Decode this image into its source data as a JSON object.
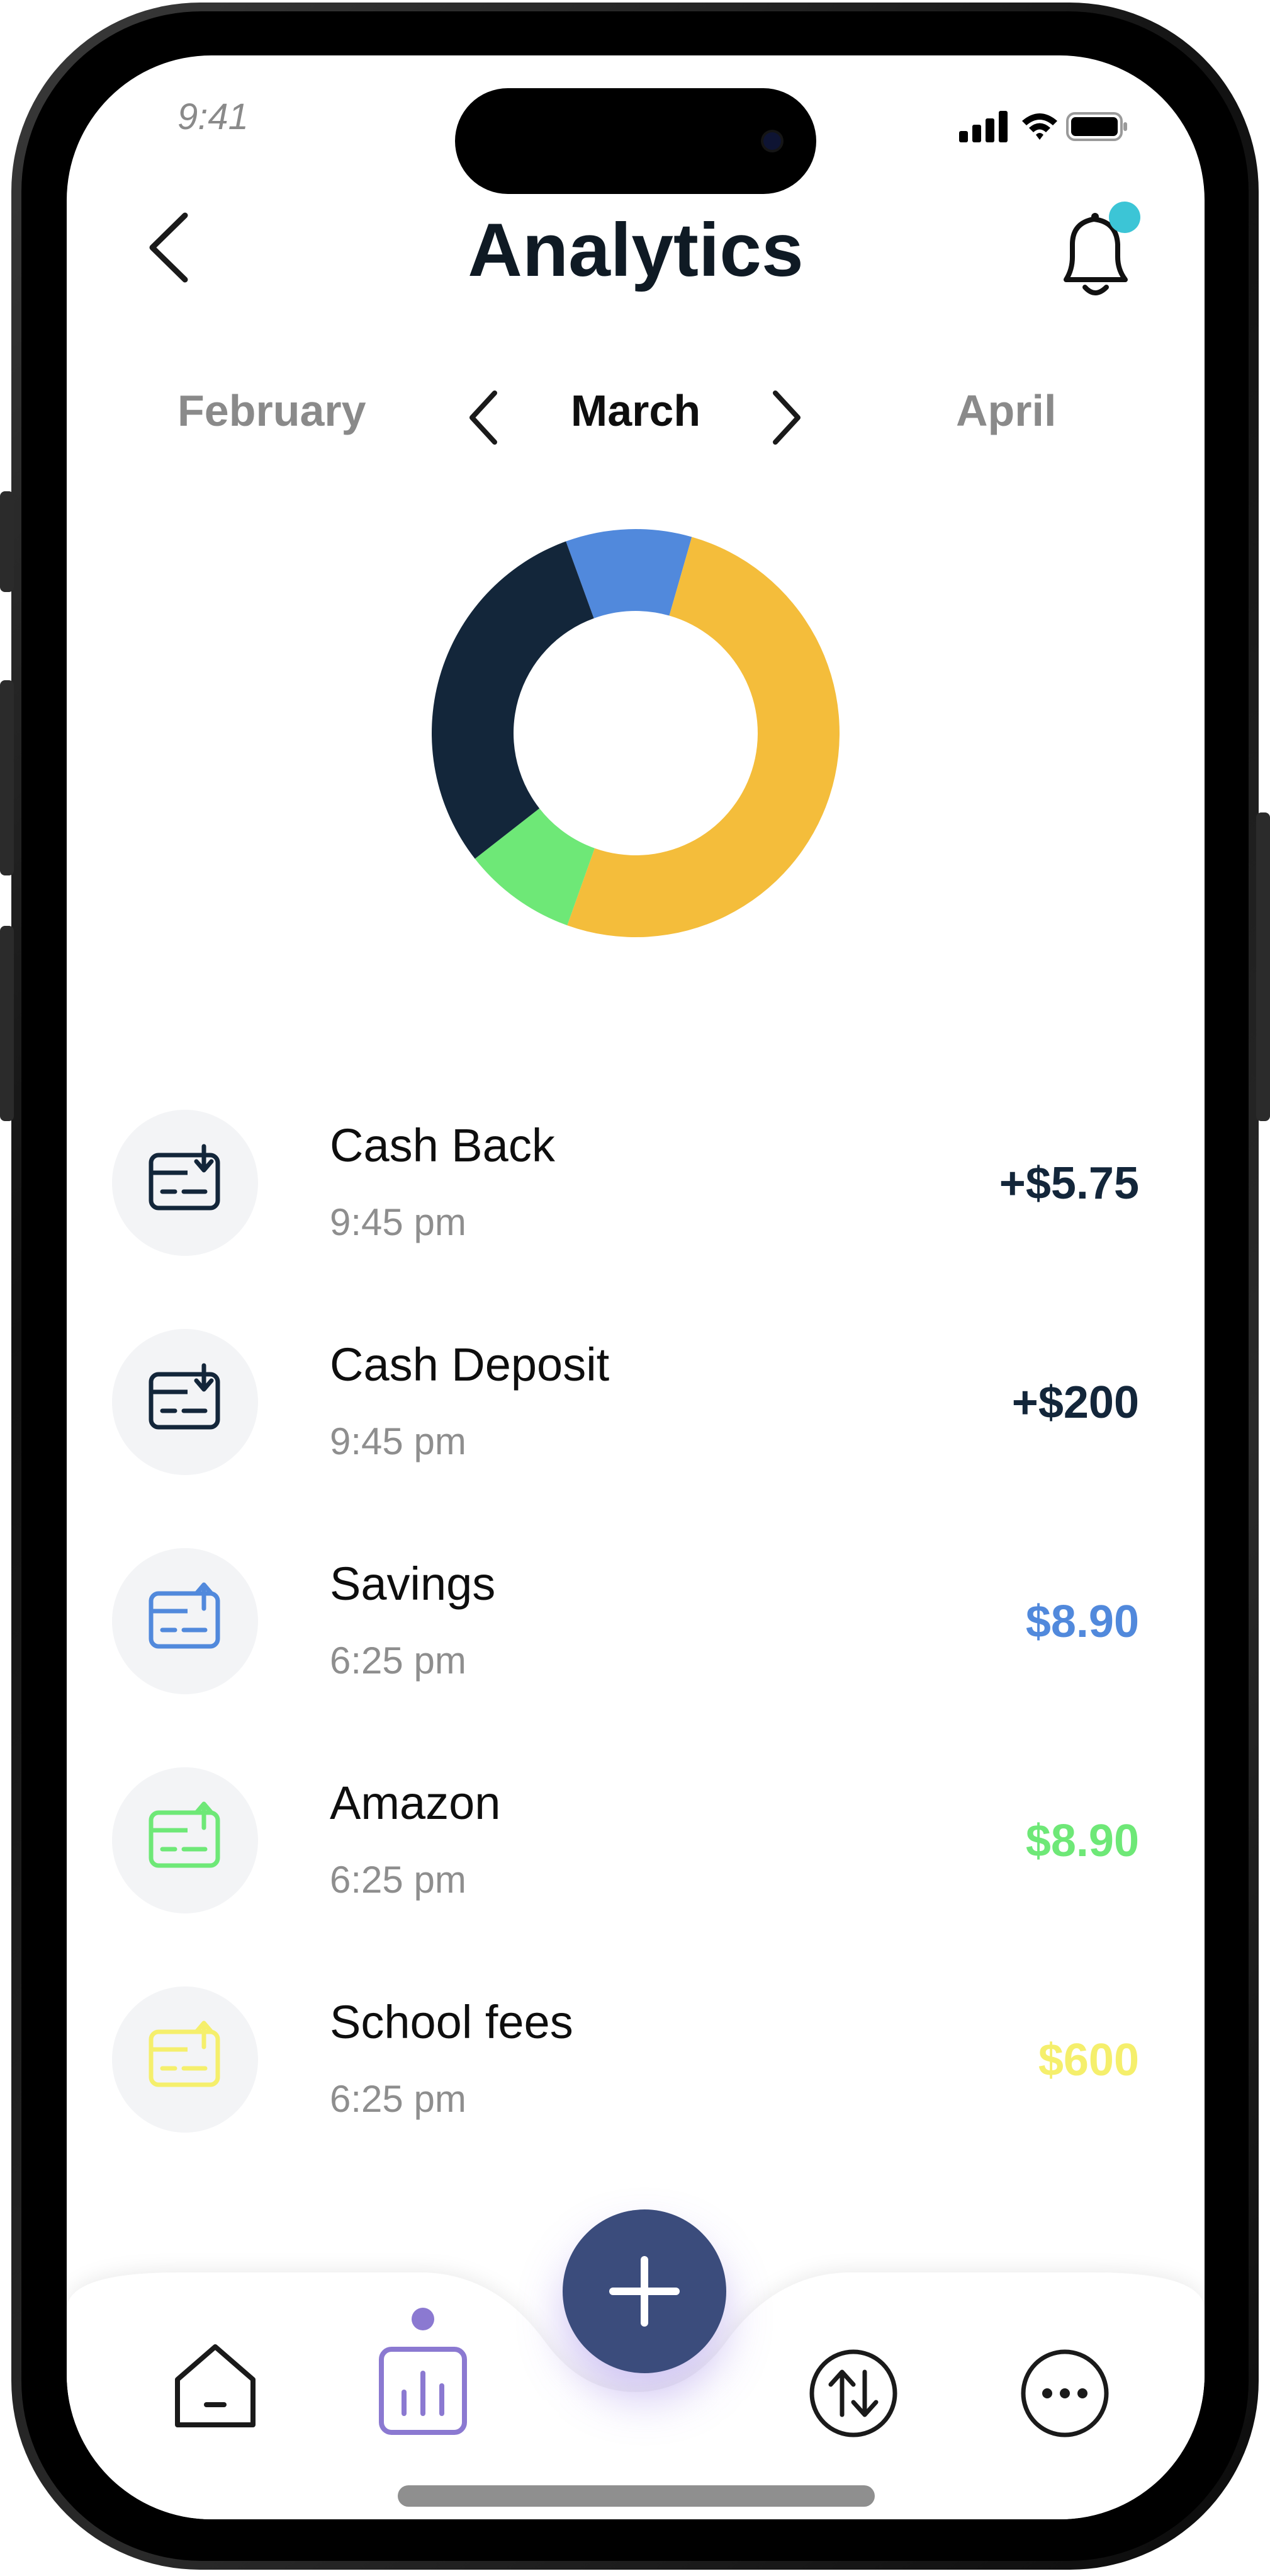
{
  "status_bar": {
    "time": "9:41"
  },
  "header": {
    "title": "Analytics"
  },
  "months": {
    "prev": "February",
    "current": "March",
    "next": "April"
  },
  "colors": {
    "navy": "#13263a",
    "blue": "#5189dc",
    "yellow": "#f4bd3b",
    "green": "#6ee877",
    "fab": "#3b4c7c",
    "nav_active": "#8b79d1",
    "notification_dot": "#3cc5d6"
  },
  "chart_data": {
    "type": "pie",
    "donut": true,
    "slices": [
      {
        "value": 10,
        "color": "#5189dc"
      },
      {
        "value": 51,
        "color": "#f4bd3b"
      },
      {
        "value": 9,
        "color": "#6ee877"
      },
      {
        "value": 30,
        "color": "#13263a"
      }
    ]
  },
  "transactions": [
    {
      "title": "Cash Back",
      "time": "9:45 pm",
      "amount": "+$5.75",
      "color": "#13263a",
      "icon": "card-download-icon"
    },
    {
      "title": "Cash Deposit",
      "time": "9:45 pm",
      "amount": "+$200",
      "color": "#13263a",
      "icon": "card-download-icon"
    },
    {
      "title": "Savings",
      "time": "6:25 pm",
      "amount": "$8.90",
      "color": "#5189dc",
      "icon": "card-upload-icon"
    },
    {
      "title": "Amazon",
      "time": "6:25 pm",
      "amount": "$8.90",
      "color": "#6ee877",
      "icon": "card-upload-icon"
    },
    {
      "title": "School fees",
      "time": "6:25 pm",
      "amount": "$600",
      "color": "#f5ef6c",
      "icon": "card-upload-icon"
    }
  ],
  "bottom_nav": {
    "items": [
      "home-icon",
      "analytics-icon",
      "add-icon",
      "transfer-icon",
      "more-icon"
    ],
    "active": "analytics-icon"
  }
}
